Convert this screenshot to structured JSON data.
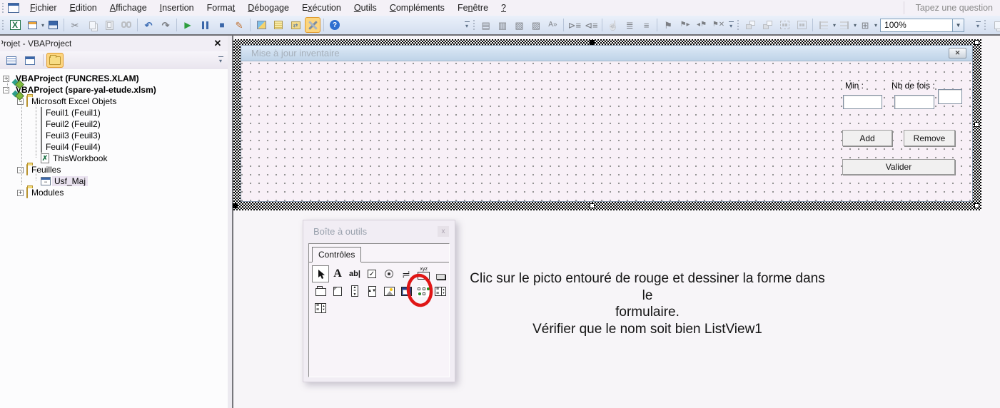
{
  "window": {
    "question_box": "Tapez une question"
  },
  "menu_bar": {
    "items": [
      {
        "label": "Fichier",
        "accel": 0
      },
      {
        "label": "Edition",
        "accel": 0
      },
      {
        "label": "Affichage",
        "accel": 0
      },
      {
        "label": "Insertion",
        "accel": 0
      },
      {
        "label": "Format",
        "accel": 5
      },
      {
        "label": "Débogage",
        "accel": 0
      },
      {
        "label": "Exécution",
        "accel": 1
      },
      {
        "label": "Outils",
        "accel": 0
      },
      {
        "label": "Compléments",
        "accel": 0
      },
      {
        "label": "Fenêtre",
        "accel": 2
      },
      {
        "label": "?",
        "accel": 0
      }
    ]
  },
  "toolbars": {
    "standard": [
      {
        "name": "excel-icon"
      },
      {
        "name": "insert-userform-icon",
        "dd": true
      },
      {
        "name": "save-icon"
      },
      {
        "sep": true
      },
      {
        "name": "cut-icon",
        "disabled": true
      },
      {
        "name": "copy-icon",
        "disabled": true
      },
      {
        "name": "paste-icon",
        "disabled": true
      },
      {
        "name": "find-icon",
        "disabled": true
      },
      {
        "sep": true
      },
      {
        "name": "undo-icon"
      },
      {
        "name": "redo-icon",
        "disabled": true
      },
      {
        "sep": true
      },
      {
        "name": "run-icon"
      },
      {
        "name": "break-icon"
      },
      {
        "name": "reset-icon"
      },
      {
        "name": "design-mode-icon"
      },
      {
        "sep": true
      },
      {
        "name": "project-explorer-icon"
      },
      {
        "name": "properties-window-icon"
      },
      {
        "name": "object-browser-icon"
      },
      {
        "name": "toolbox-icon",
        "active": true
      },
      {
        "sep": true
      },
      {
        "name": "help-icon"
      }
    ],
    "edit": [
      {
        "name": "list-properties-icon",
        "disabled": true
      },
      {
        "name": "list-constants-icon",
        "disabled": true
      },
      {
        "name": "quick-info-icon",
        "disabled": true
      },
      {
        "name": "parameter-info-icon",
        "disabled": true
      },
      {
        "name": "complete-word-icon",
        "disabled": true
      },
      {
        "sep": true
      },
      {
        "name": "indent-icon",
        "disabled": true
      },
      {
        "name": "outdent-icon",
        "disabled": true
      },
      {
        "sep": true
      },
      {
        "name": "toggle-breakpoint-icon",
        "disabled": true
      },
      {
        "name": "comment-block-icon",
        "disabled": true
      },
      {
        "name": "uncomment-block-icon",
        "disabled": true
      },
      {
        "sep": true
      },
      {
        "name": "toggle-bookmark-icon",
        "disabled": true
      },
      {
        "name": "next-bookmark-icon",
        "disabled": true
      },
      {
        "name": "previous-bookmark-icon",
        "disabled": true
      },
      {
        "name": "clear-bookmarks-icon",
        "disabled": true
      }
    ],
    "userform": [
      {
        "name": "bring-to-front-icon",
        "disabled": true
      },
      {
        "name": "send-to-back-icon",
        "disabled": true
      },
      {
        "name": "group-icon",
        "disabled": true
      },
      {
        "name": "ungroup-icon",
        "disabled": true
      },
      {
        "sep": true
      },
      {
        "name": "align-icon",
        "disabled": true,
        "dd": true
      },
      {
        "name": "center-icon",
        "disabled": true,
        "dd": true
      },
      {
        "name": "arrange-buttons-icon",
        "disabled": true,
        "dd": true
      }
    ],
    "zoom_value": "100%",
    "trailing": [
      {
        "name": "docking-icon",
        "disabled": true
      }
    ]
  },
  "project_panel": {
    "title": "Projet - VBAProject",
    "buttons": [
      {
        "name": "view-code-icon"
      },
      {
        "name": "view-object-icon"
      },
      {
        "name": "toggle-folders-icon",
        "active": true
      }
    ],
    "tree": [
      {
        "label": "VBAProject (FUNCRES.XLAM)",
        "depth": 0,
        "icon": "project",
        "expand": "+",
        "bold": true
      },
      {
        "label": "VBAProject (spare-yal-etude.xlsm)",
        "depth": 0,
        "icon": "project",
        "expand": "-",
        "bold": true
      },
      {
        "label": "Microsoft Excel Objets",
        "depth": 1,
        "icon": "folder-open",
        "expand": "-"
      },
      {
        "label": "Feuil1 (Feuil1)",
        "depth": 2,
        "icon": "worksheet"
      },
      {
        "label": "Feuil2 (Feuil2)",
        "depth": 2,
        "icon": "worksheet"
      },
      {
        "label": "Feuil3 (Feuil3)",
        "depth": 2,
        "icon": "worksheet"
      },
      {
        "label": "Feuil4 (Feuil4)",
        "depth": 2,
        "icon": "worksheet"
      },
      {
        "label": "ThisWorkbook",
        "depth": 2,
        "icon": "workbook"
      },
      {
        "label": "Feuilles",
        "depth": 1,
        "icon": "folder-open",
        "expand": "-"
      },
      {
        "label": "Usf_Maj",
        "depth": 2,
        "icon": "userform",
        "selected": true
      },
      {
        "label": "Modules",
        "depth": 1,
        "icon": "folder-closed",
        "expand": "+"
      }
    ]
  },
  "form_designer": {
    "title": "Mise à jour inventaire",
    "min_label": "Min :",
    "nb_label": "Nb de fois :",
    "min_value": "",
    "nb_value": "",
    "extra_value": "",
    "add_button": "Add",
    "remove_button": "Remove",
    "valider_button": "Valider"
  },
  "toolbox": {
    "title": "Boîte à outils",
    "tab": "Contrôles",
    "rows": [
      [
        "select",
        "label",
        "textbox",
        "checkbox",
        "optionbutton",
        "togglebutton",
        "frame",
        "commandbutton"
      ],
      [
        "tabstrip",
        "multipage",
        "scrollbar",
        "spinbutton",
        "image",
        "refedit",
        "listview",
        "imagecombo"
      ],
      [
        "treeview"
      ]
    ],
    "circled": "listview",
    "circle_color": "#e01616"
  },
  "instruction": {
    "lines": [
      "Clic sur le picto entouré de rouge et dessiner la forme dans le",
      "formulaire.",
      "Vérifier que le nom soit bien ListView1"
    ]
  }
}
